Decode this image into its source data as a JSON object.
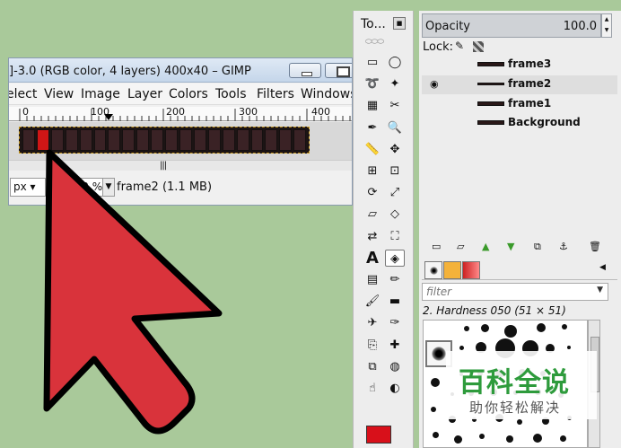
{
  "main_window": {
    "title": "]-3.0 (RGB color, 4 layers) 400x40 – GIMP",
    "menu": [
      "elect",
      "View",
      "Image",
      "Layer",
      "Colors",
      "Tools",
      "Filters",
      "Windows"
    ],
    "ruler_labels": [
      "0",
      "100",
      "200",
      "300",
      "400"
    ],
    "frame_count": 20,
    "active_frame_index": 1,
    "status": {
      "unit": "px",
      "zoom": "100 %",
      "layer_info": "frame2 (1.1 MB)"
    }
  },
  "toolbox": {
    "title": "To...",
    "fg_color": "#d8101a",
    "tools": [
      "rect-select-icon",
      "ellipse-select-icon",
      "free-select-icon",
      "fuzzy-select-icon",
      "color-select-icon",
      "scissors-icon",
      "color-picker-icon",
      "zoom-icon",
      "measure-icon",
      "move-icon",
      "align-icon",
      "crop-icon",
      "rotate-icon",
      "scale-icon",
      "shear-icon",
      "perspective-icon",
      "flip-icon",
      "paint-bucket-icon",
      "text-icon",
      "bucket-fill-icon",
      "blend-icon",
      "pencil-icon",
      "paintbrush-icon",
      "eraser-icon",
      "airbrush-icon",
      "ink-icon",
      "clone-icon",
      "heal-icon",
      "perspective-clone-icon",
      "blur-icon",
      "smudge-icon",
      "dodge-burn-icon"
    ]
  },
  "layers_panel": {
    "opacity_label": "Opacity",
    "opacity_value": "100.0",
    "lock_label": "Lock:",
    "layers": [
      {
        "name": "frame3",
        "visible": false,
        "selected": false
      },
      {
        "name": "frame2",
        "visible": true,
        "selected": true
      },
      {
        "name": "frame1",
        "visible": false,
        "selected": false
      },
      {
        "name": "Background",
        "visible": false,
        "selected": false
      }
    ]
  },
  "brushes_panel": {
    "filter_placeholder": "filter",
    "current_brush": "2. Hardness 050 (51 × 51)"
  },
  "watermark": {
    "logo": "百科全说",
    "subtitle": "助你轻松解决"
  },
  "colors": {
    "arrow_fill": "#d9333b",
    "active_frame": "#d01616"
  }
}
